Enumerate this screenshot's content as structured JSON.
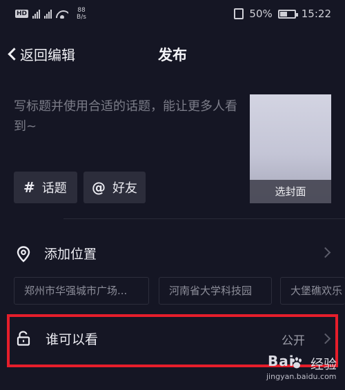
{
  "status_bar": {
    "hd": "HD",
    "net1": "4G",
    "net2": "4G",
    "speed_value": "88",
    "speed_unit": "B/s",
    "battery": "50%",
    "time": "15:22"
  },
  "nav": {
    "back_label": "返回编辑",
    "title": "发布"
  },
  "caption": {
    "placeholder": "写标题并使用合适的话题，能让更多人看到~"
  },
  "cover": {
    "label": "选封面"
  },
  "chips": {
    "topic_symbol": "#",
    "topic_label": "话题",
    "friend_symbol": "@",
    "friend_label": "好友"
  },
  "location": {
    "label": "添加位置",
    "suggestions": [
      "郑州市华强城市广场...",
      "河南省大学科技园",
      "大堡礁欢乐"
    ]
  },
  "privacy": {
    "label": "谁可以看",
    "value": "公开"
  },
  "watermark": {
    "brand_left": "Bai",
    "brand_right": "经验",
    "url": "jingyan.baidu.com"
  },
  "colors": {
    "background": "#151624",
    "highlight": "#e51e2b",
    "chip_bg": "#2c2d3b"
  }
}
